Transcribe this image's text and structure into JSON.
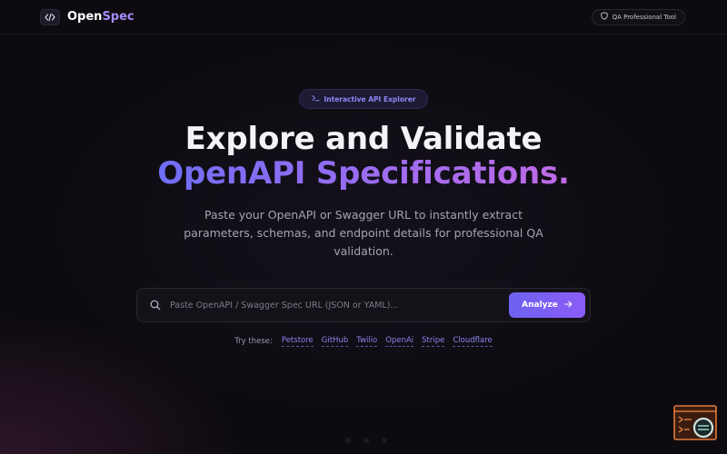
{
  "brand": {
    "name_part1": "Open",
    "name_part2": "Spec",
    "icon": "code-icon"
  },
  "header": {
    "badge_label": "QA Professional Tool",
    "badge_icon": "shield-icon"
  },
  "hero": {
    "pill_label": "Interactive API Explorer",
    "pill_icon": "terminal-icon",
    "title_line1": "Explore and Validate",
    "title_line2": "OpenAPI Specifications.",
    "subtitle": "Paste your OpenAPI or Swagger URL to instantly extract parameters, schemas, and endpoint details for professional QA validation."
  },
  "search": {
    "placeholder": "Paste OpenAPI / Swagger Spec URL (JSON or YAML)...",
    "value": "",
    "button_label": "Analyze",
    "search_icon": "search-icon",
    "button_icon": "arrow-right-icon"
  },
  "examples": {
    "label": "Try these:",
    "items": [
      "Petstore",
      "GitHub",
      "Twilio",
      "OpenAi",
      "Stripe",
      "Cloudflare"
    ]
  },
  "colors": {
    "background": "#0d0b10",
    "accent": "#8b5cf6",
    "accent_blue": "#6f6ef6",
    "link": "#8b86f0"
  }
}
